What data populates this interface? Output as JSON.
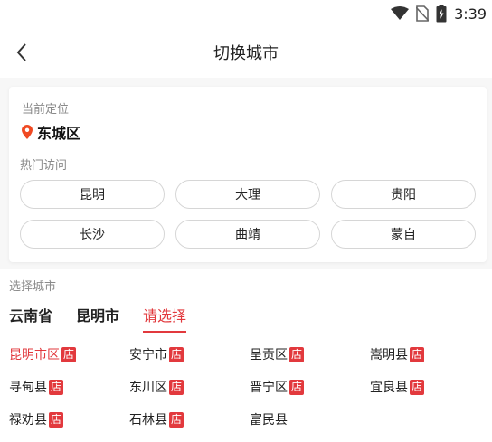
{
  "status_bar": {
    "time": "3:39"
  },
  "header": {
    "title": "切换城市"
  },
  "current_location": {
    "label": "当前定位",
    "city": "东城区"
  },
  "hot": {
    "label": "热门访问",
    "cities": [
      "昆明",
      "大理",
      "贵阳",
      "长沙",
      "曲靖",
      "蒙自"
    ]
  },
  "select": {
    "label": "选择城市",
    "tabs": [
      "云南省",
      "昆明市",
      "请选择"
    ]
  },
  "shop_badge": "店",
  "counties": [
    {
      "name": "昆明市区",
      "shop": true,
      "selected": true
    },
    {
      "name": "安宁市",
      "shop": true
    },
    {
      "name": "呈贡区",
      "shop": true
    },
    {
      "name": "嵩明县",
      "shop": true
    },
    {
      "name": "寻甸县",
      "shop": true
    },
    {
      "name": "东川区",
      "shop": true
    },
    {
      "name": "晋宁区",
      "shop": true
    },
    {
      "name": "宜良县",
      "shop": true
    },
    {
      "name": "禄劝县",
      "shop": true
    },
    {
      "name": "石林县",
      "shop": true
    },
    {
      "name": "富民县",
      "shop": false
    }
  ],
  "colors": {
    "accent": "#e2393d",
    "location_pin": "#f04a23"
  }
}
